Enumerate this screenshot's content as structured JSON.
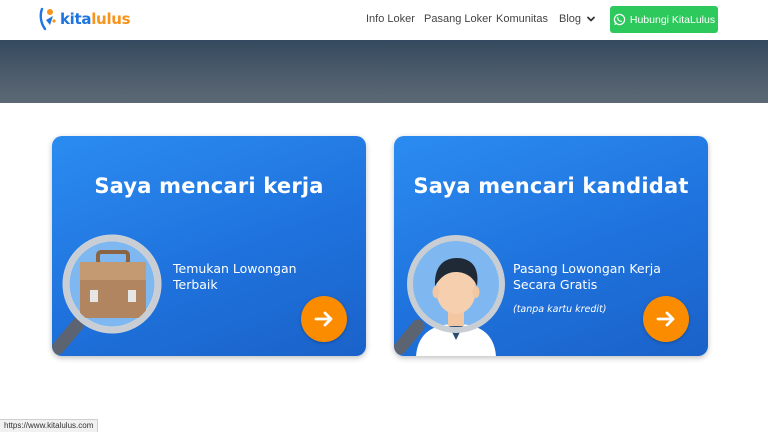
{
  "header": {
    "logo": {
      "text_primary": "kita",
      "text_accent": "lulus"
    },
    "nav": [
      {
        "label": "Info Loker"
      },
      {
        "label": "Pasang Loker"
      },
      {
        "label": "Komunitas"
      },
      {
        "label": "Blog"
      }
    ],
    "cta": {
      "label": "Hubungi KitaLulus",
      "icon": "whatsapp-icon"
    }
  },
  "cards": [
    {
      "title": "Saya mencari kerja",
      "subtitle": "Temukan Lowongan Terbaik",
      "icon": "briefcase-magnifier-icon",
      "button_icon": "arrow-right-icon"
    },
    {
      "title": "Saya mencari kandidat",
      "subtitle": "Pasang Lowongan Kerja Secara Gratis",
      "note": "(tanpa kartu kredit)",
      "icon": "person-magnifier-icon",
      "button_icon": "arrow-right-icon"
    }
  ],
  "status_bar": {
    "url": "https://www.kitalulus.com"
  },
  "colors": {
    "brand_blue": "#1e74e0",
    "brand_orange": "#f7941d",
    "whatsapp_green": "#2ec95c",
    "card_blue": "#1f72dd",
    "arrow_orange": "#fb8c00"
  }
}
